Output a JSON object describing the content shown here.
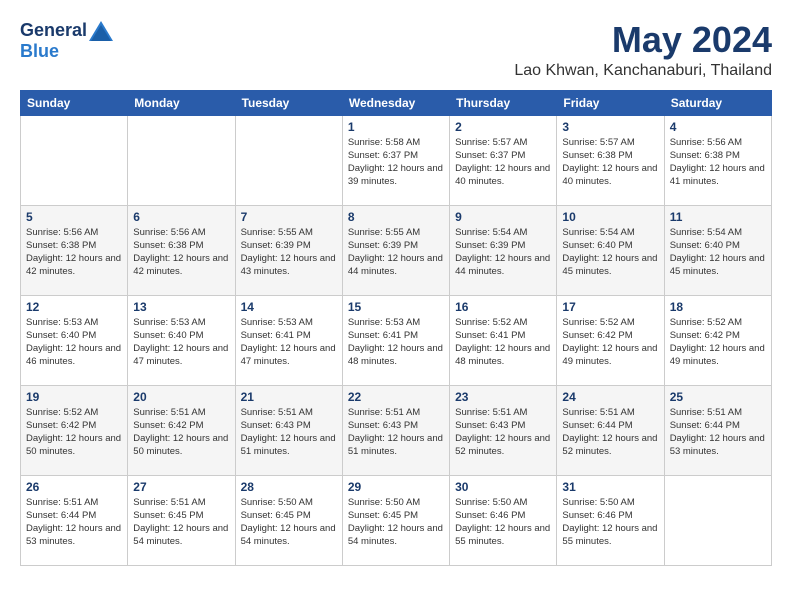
{
  "header": {
    "logo": {
      "general": "General",
      "blue": "Blue"
    },
    "title": "May 2024",
    "location": "Lao Khwan, Kanchanaburi, Thailand"
  },
  "weekdays": [
    "Sunday",
    "Monday",
    "Tuesday",
    "Wednesday",
    "Thursday",
    "Friday",
    "Saturday"
  ],
  "weeks": [
    [
      {
        "day": "",
        "info": ""
      },
      {
        "day": "",
        "info": ""
      },
      {
        "day": "",
        "info": ""
      },
      {
        "day": "1",
        "info": "Sunrise: 5:58 AM\nSunset: 6:37 PM\nDaylight: 12 hours\nand 39 minutes."
      },
      {
        "day": "2",
        "info": "Sunrise: 5:57 AM\nSunset: 6:37 PM\nDaylight: 12 hours\nand 40 minutes."
      },
      {
        "day": "3",
        "info": "Sunrise: 5:57 AM\nSunset: 6:38 PM\nDaylight: 12 hours\nand 40 minutes."
      },
      {
        "day": "4",
        "info": "Sunrise: 5:56 AM\nSunset: 6:38 PM\nDaylight: 12 hours\nand 41 minutes."
      }
    ],
    [
      {
        "day": "5",
        "info": "Sunrise: 5:56 AM\nSunset: 6:38 PM\nDaylight: 12 hours\nand 42 minutes."
      },
      {
        "day": "6",
        "info": "Sunrise: 5:56 AM\nSunset: 6:38 PM\nDaylight: 12 hours\nand 42 minutes."
      },
      {
        "day": "7",
        "info": "Sunrise: 5:55 AM\nSunset: 6:39 PM\nDaylight: 12 hours\nand 43 minutes."
      },
      {
        "day": "8",
        "info": "Sunrise: 5:55 AM\nSunset: 6:39 PM\nDaylight: 12 hours\nand 44 minutes."
      },
      {
        "day": "9",
        "info": "Sunrise: 5:54 AM\nSunset: 6:39 PM\nDaylight: 12 hours\nand 44 minutes."
      },
      {
        "day": "10",
        "info": "Sunrise: 5:54 AM\nSunset: 6:40 PM\nDaylight: 12 hours\nand 45 minutes."
      },
      {
        "day": "11",
        "info": "Sunrise: 5:54 AM\nSunset: 6:40 PM\nDaylight: 12 hours\nand 45 minutes."
      }
    ],
    [
      {
        "day": "12",
        "info": "Sunrise: 5:53 AM\nSunset: 6:40 PM\nDaylight: 12 hours\nand 46 minutes."
      },
      {
        "day": "13",
        "info": "Sunrise: 5:53 AM\nSunset: 6:40 PM\nDaylight: 12 hours\nand 47 minutes."
      },
      {
        "day": "14",
        "info": "Sunrise: 5:53 AM\nSunset: 6:41 PM\nDaylight: 12 hours\nand 47 minutes."
      },
      {
        "day": "15",
        "info": "Sunrise: 5:53 AM\nSunset: 6:41 PM\nDaylight: 12 hours\nand 48 minutes."
      },
      {
        "day": "16",
        "info": "Sunrise: 5:52 AM\nSunset: 6:41 PM\nDaylight: 12 hours\nand 48 minutes."
      },
      {
        "day": "17",
        "info": "Sunrise: 5:52 AM\nSunset: 6:42 PM\nDaylight: 12 hours\nand 49 minutes."
      },
      {
        "day": "18",
        "info": "Sunrise: 5:52 AM\nSunset: 6:42 PM\nDaylight: 12 hours\nand 49 minutes."
      }
    ],
    [
      {
        "day": "19",
        "info": "Sunrise: 5:52 AM\nSunset: 6:42 PM\nDaylight: 12 hours\nand 50 minutes."
      },
      {
        "day": "20",
        "info": "Sunrise: 5:51 AM\nSunset: 6:42 PM\nDaylight: 12 hours\nand 50 minutes."
      },
      {
        "day": "21",
        "info": "Sunrise: 5:51 AM\nSunset: 6:43 PM\nDaylight: 12 hours\nand 51 minutes."
      },
      {
        "day": "22",
        "info": "Sunrise: 5:51 AM\nSunset: 6:43 PM\nDaylight: 12 hours\nand 51 minutes."
      },
      {
        "day": "23",
        "info": "Sunrise: 5:51 AM\nSunset: 6:43 PM\nDaylight: 12 hours\nand 52 minutes."
      },
      {
        "day": "24",
        "info": "Sunrise: 5:51 AM\nSunset: 6:44 PM\nDaylight: 12 hours\nand 52 minutes."
      },
      {
        "day": "25",
        "info": "Sunrise: 5:51 AM\nSunset: 6:44 PM\nDaylight: 12 hours\nand 53 minutes."
      }
    ],
    [
      {
        "day": "26",
        "info": "Sunrise: 5:51 AM\nSunset: 6:44 PM\nDaylight: 12 hours\nand 53 minutes."
      },
      {
        "day": "27",
        "info": "Sunrise: 5:51 AM\nSunset: 6:45 PM\nDaylight: 12 hours\nand 54 minutes."
      },
      {
        "day": "28",
        "info": "Sunrise: 5:50 AM\nSunset: 6:45 PM\nDaylight: 12 hours\nand 54 minutes."
      },
      {
        "day": "29",
        "info": "Sunrise: 5:50 AM\nSunset: 6:45 PM\nDaylight: 12 hours\nand 54 minutes."
      },
      {
        "day": "30",
        "info": "Sunrise: 5:50 AM\nSunset: 6:46 PM\nDaylight: 12 hours\nand 55 minutes."
      },
      {
        "day": "31",
        "info": "Sunrise: 5:50 AM\nSunset: 6:46 PM\nDaylight: 12 hours\nand 55 minutes."
      },
      {
        "day": "",
        "info": ""
      }
    ]
  ]
}
